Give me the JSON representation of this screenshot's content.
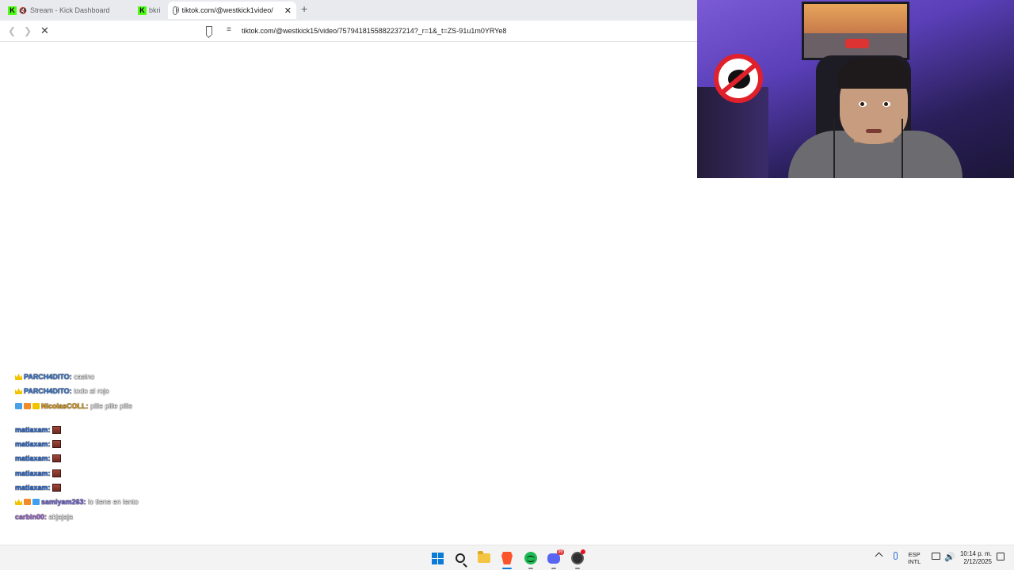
{
  "browser": {
    "tabs": [
      {
        "title": "Stream - Kick Dashboard",
        "favicon": "kick-icon",
        "muted": true,
        "active": false
      },
      {
        "title": "bkri",
        "favicon": "kick-icon",
        "muted": false,
        "active": false
      },
      {
        "title": "tiktok.com/@westkick1",
        "suffix": "video/",
        "favicon": "globe-icon",
        "active": true
      }
    ],
    "new_tab_label": "+",
    "close_label": "✕",
    "url": "tiktok.com/@westkick15/video/7579418155882237214?_r=1&_t=ZS-91u1m0YRYe8",
    "loading": true
  },
  "chat": {
    "messages": [
      {
        "user": "PARCH4DITO:",
        "user_color": "#3d7bd4",
        "text": "casino",
        "badges": [
          "crown"
        ],
        "emotes": 0
      },
      {
        "user": "PARCH4DITO:",
        "user_color": "#3d7bd4",
        "text": "todo al rojo",
        "badges": [
          "crown"
        ],
        "emotes": 0
      },
      {
        "user": "NicolasCOLL:",
        "user_color": "#e6a017",
        "text": "pille pille pille",
        "badges": [
          "sword",
          "gift",
          "coin"
        ],
        "emotes": 0,
        "link": "https://vt.tiktok.com/ZSfGcSf3/"
      },
      {
        "user": "matiaxam:",
        "user_color": "#2f6fd8",
        "text": "",
        "badges": [],
        "emotes": 1
      },
      {
        "user": "matiaxam:",
        "user_color": "#2f6fd8",
        "text": "",
        "badges": [],
        "emotes": 1
      },
      {
        "user": "matiaxam:",
        "user_color": "#2f6fd8",
        "text": "",
        "badges": [],
        "emotes": 1
      },
      {
        "user": "matiaxam:",
        "user_color": "#2f6fd8",
        "text": "",
        "badges": [],
        "emotes": 1
      },
      {
        "user": "matiaxam:",
        "user_color": "#2f6fd8",
        "text": "",
        "badges": [],
        "emotes": 1
      },
      {
        "user": "samiyam263:",
        "user_color": "#7b6fe0",
        "text": "lo tiene en lento",
        "badges": [
          "crown",
          "gift",
          "diamond"
        ],
        "emotes": 0
      },
      {
        "user": "carbin00:",
        "user_color": "#a46fd8",
        "text": "akjajaja",
        "badges": [],
        "emotes": 0
      }
    ]
  },
  "taskbar": {
    "apps": [
      "windows-start",
      "search",
      "file-explorer",
      "brave-browser",
      "spotify",
      "discord",
      "obs-studio"
    ],
    "discord_badge": "99",
    "tray": {
      "lang_line1": "ESP",
      "lang_line2": "INTL",
      "time": "10:14 p. m.",
      "date": "2/12/2025"
    }
  },
  "colors": {
    "kick_green": "#53fc18",
    "taskbar_bg": "#f3f3f3",
    "tab_strip": "#e8eaed"
  }
}
